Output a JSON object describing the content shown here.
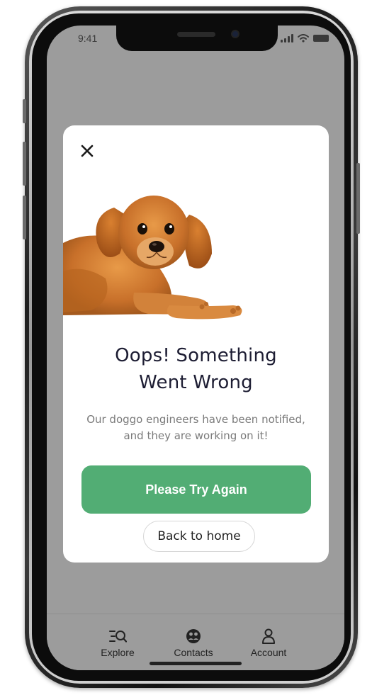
{
  "status_bar": {
    "time": "9:41"
  },
  "modal": {
    "title_line1": "Oops! Something",
    "title_line2": "Went Wrong",
    "message_line1": "Our doggo engineers have been notified,",
    "message_line2": "and they are working on it!",
    "retry_label": "Please Try Again",
    "home_label": "Back to home",
    "close_icon": "close-icon",
    "illustration": "dog-illustration"
  },
  "bottom_nav": {
    "items": [
      {
        "label": "Explore",
        "icon": "explore-icon"
      },
      {
        "label": "Contacts",
        "icon": "contacts-icon"
      },
      {
        "label": "Account",
        "icon": "account-icon"
      }
    ]
  },
  "colors": {
    "accent": "#52ad74",
    "screen_overlay": "#9c9c9c",
    "title": "#1d1d33",
    "message": "#7a7a7a"
  }
}
